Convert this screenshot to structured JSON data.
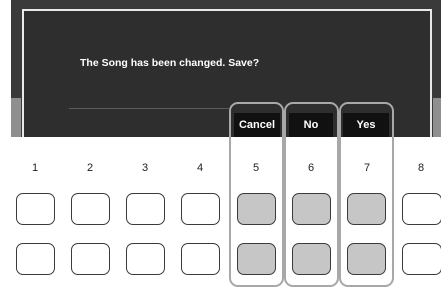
{
  "dialog": {
    "message": "The Song has been changed. Save?"
  },
  "softkeys": [
    {
      "label": "Cancel"
    },
    {
      "label": "No"
    },
    {
      "label": "Yes"
    }
  ],
  "columns": [
    "1",
    "2",
    "3",
    "4",
    "5",
    "6",
    "7",
    "8"
  ],
  "colors": {
    "screen_bg": "#3a3a3a",
    "dialog_bg": "#2e2e2e",
    "softkey_bg": "#111111",
    "highlight": "#a8a8a8",
    "active_button": "#c6c6c6"
  }
}
